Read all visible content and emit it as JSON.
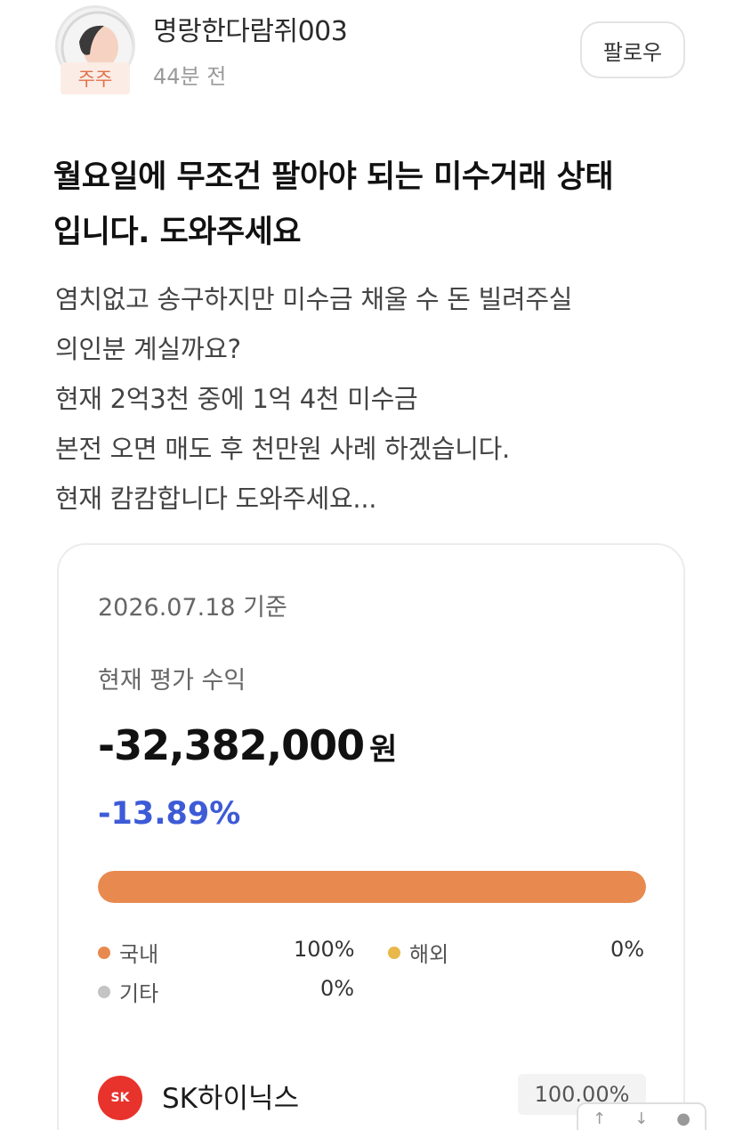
{
  "post": {
    "author": "명랑한다람쥐003",
    "badge": "주주",
    "time": "44분 전",
    "follow_label": "팔로우",
    "title_lines": [
      "월요일에 무조건 팔아야 되는 미수거래 상태",
      "입니다. 도와주세요"
    ],
    "body_lines": [
      "염치없고 송구하지만 미수금 채울 수 돈 빌려주실",
      "의인분 계실까요?",
      "현재 2억3천 중에 1억 4천 미수금",
      "본전 오면 매도 후 천만원 사례 하겠습니다.",
      "현재 캄캄합니다 도와주세요..."
    ]
  },
  "portfolio": {
    "date": "2026.07.18 기준",
    "eval_label": "현재 평가 수익",
    "amount": "-32,382,000",
    "amount_unit": "원",
    "percent": "-13.89%",
    "domestic_fill_fraction": 1.0,
    "legend": [
      {
        "label": "국내",
        "value": "100%",
        "color": "#e88a4f"
      },
      {
        "label": "해외",
        "value": "0%",
        "color": "#e8b84a"
      },
      {
        "label": "기타",
        "value": "0%",
        "color": "#c4c4c4"
      }
    ],
    "holding": {
      "logo_text": "SK",
      "name": "SK하이닉스",
      "weight": "100.00%"
    }
  },
  "floating_controls": {
    "up_icon": "arrow-up-icon",
    "down_icon": "arrow-down-icon",
    "comment_icon": "comment-icon"
  }
}
